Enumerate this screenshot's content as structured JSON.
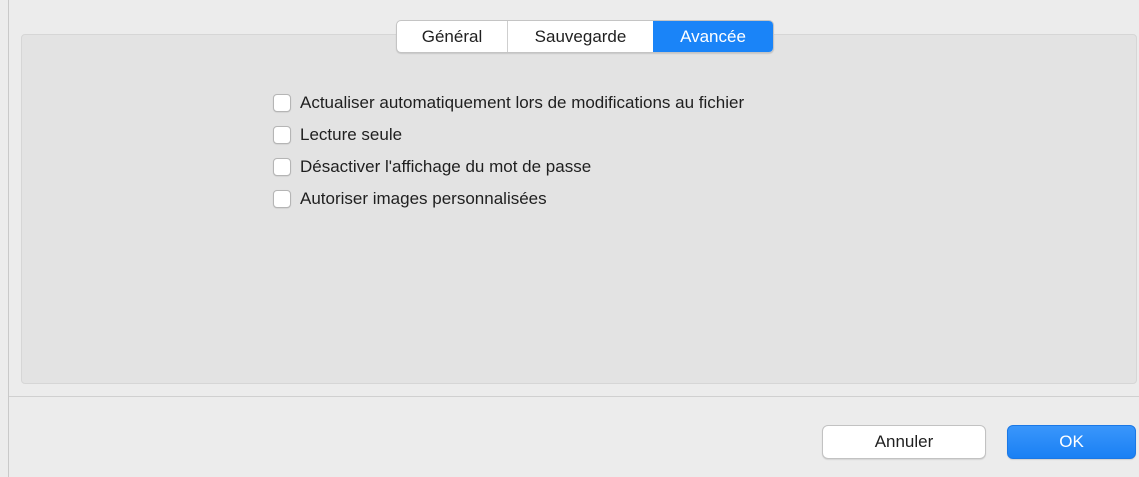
{
  "tabs": [
    {
      "label": "Général",
      "active": false
    },
    {
      "label": "Sauvegarde",
      "active": false
    },
    {
      "label": "Avancée",
      "active": true
    }
  ],
  "options": [
    {
      "label": "Actualiser automatiquement lors de modifications au fichier",
      "checked": false
    },
    {
      "label": "Lecture seule",
      "checked": false
    },
    {
      "label": "Désactiver l'affichage du mot de passe",
      "checked": false
    },
    {
      "label": "Autoriser images personnalisées",
      "checked": false
    }
  ],
  "buttons": {
    "cancel_label": "Annuler",
    "ok_label": "OK"
  },
  "colors": {
    "accent": "#1a84f8",
    "background": "#ececec",
    "panel": "#e3e3e3"
  }
}
